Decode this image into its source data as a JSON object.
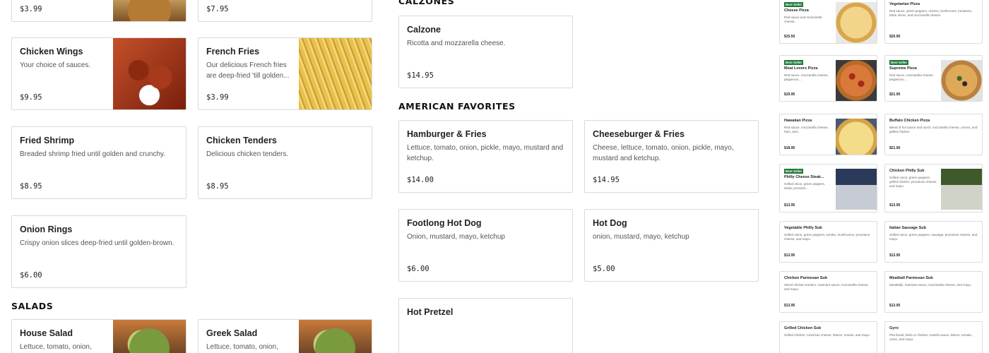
{
  "top_partial": [
    {
      "price": "$3.99"
    },
    {
      "price": "$7.95"
    }
  ],
  "menu_left": [
    {
      "name": "Chicken Wings",
      "desc": "Your choice of sauces.",
      "price": "$9.95"
    },
    {
      "name": "French Fries",
      "desc": "Our delicious French fries are deep-fried 'till golden...",
      "price": "$3.99"
    },
    {
      "name": "Fried Shrimp",
      "desc": "Breaded shrimp fried until golden and crunchy.",
      "price": "$8.95"
    },
    {
      "name": "Chicken Tenders",
      "desc": "Delicious chicken tenders.",
      "price": "$8.95"
    },
    {
      "name": "Onion Rings",
      "desc": "Crispy onion slices deep-fried until golden-brown.",
      "price": "$6.00"
    }
  ],
  "salads": {
    "title": "SALADS",
    "items": [
      {
        "name": "House Salad",
        "desc": "Lettuce, tomato, onion,"
      },
      {
        "name": "Greek Salad",
        "desc": "Lettuce, tomato, onion,"
      }
    ]
  },
  "calzones": {
    "title": "CALZONES",
    "items": [
      {
        "name": "Calzone",
        "desc": "Ricotta and mozzarella cheese.",
        "price": "$14.95"
      }
    ]
  },
  "american": {
    "title": "AMERICAN FAVORITES",
    "items": [
      {
        "name": "Hamburger & Fries",
        "desc": "Lettuce, tomato, onion, pickle, mayo, mustard and ketchup.",
        "price": "$14.00"
      },
      {
        "name": "Cheeseburger & Fries",
        "desc": "Cheese, lettuce, tomato, onion, pickle, mayo, mustard and ketchup.",
        "price": "$14.95"
      },
      {
        "name": "Footlong Hot Dog",
        "desc": "Onion, mustard, mayo, ketchup",
        "price": "$6.00"
      },
      {
        "name": "Hot Dog",
        "desc": "onion, mustard, mayo, ketchup",
        "price": "$5.00"
      },
      {
        "name": "Hot Pretzel",
        "desc": "",
        "price": ""
      }
    ]
  },
  "right_menu": {
    "badge": "Best Seller",
    "items": [
      {
        "name": "Cheese Pizza",
        "desc": "Red sauce and mozzarella cheese.",
        "price": "$15.50",
        "best": true
      },
      {
        "name": "Vegetarian Pizza",
        "desc": "Red sauce, green peppers, onions, mushrooms, tomatoes, black olives, and mozzarella cheese.",
        "price": "$20.95",
        "best": false
      },
      {
        "name": "Meat Lovers Pizza",
        "desc": "Red sauce, mozzarella cheese, pepperoni,...",
        "price": "$19.95",
        "best": true
      },
      {
        "name": "Supreme Pizza",
        "desc": "Red sauce, mozzarella cheese, pepperoni,...",
        "price": "$21.95",
        "best": true
      },
      {
        "name": "Hawaiian Pizza",
        "desc": "Red sauce, mozzarella cheese, ham, and...",
        "price": "$18.95",
        "best": false
      },
      {
        "name": "Buffalo Chicken Pizza",
        "desc": "Blend of hot sauce and ranch, mozzarella cheese, onions, and grilled chicken.",
        "price": "$21.95",
        "best": false
      },
      {
        "name": "Philly Cheese Steak...",
        "desc": "Grilled onion, green peppers, steak, provolon...",
        "price": "$13.95",
        "best": true
      },
      {
        "name": "Chicken Philly Sub",
        "desc": "Grilled onion, green peppers, grilled chicken, provolone cheese, and mayo.",
        "price": "$13.95",
        "best": false
      },
      {
        "name": "Vegetable Philly Sub",
        "desc": "Grilled onion, green peppers, tomato, mushrooms, provolone cheese, and mayo.",
        "price": "$13.95",
        "best": false
      },
      {
        "name": "Italian Sausage Sub",
        "desc": "Grilled onion, green peppers, sausage, provolone cheese, and mayo.",
        "price": "$13.95",
        "best": false
      },
      {
        "name": "Chicken Parmesan Sub",
        "desc": "Sliced chicken tenders, marinara sauce, mozzarella cheese, and mayo.",
        "price": "$13.95",
        "best": false
      },
      {
        "name": "Meatball Parmesan Sub",
        "desc": "Meatballs, marinara sauce, mozzarella cheese, and mayo.",
        "price": "$13.95",
        "best": false
      },
      {
        "name": "Grilled Chicken Sub",
        "desc": "Grilled chicken, American cheese, lettuce, tomato, and mayo.",
        "price": "",
        "best": false
      },
      {
        "name": "Gyro",
        "desc": "Pita bread, lamb or chicken, tzatziki sauce, lettuce, tomato, onion, and mayo.",
        "price": "",
        "best": false
      }
    ]
  },
  "icons": [
    "food-photo"
  ]
}
